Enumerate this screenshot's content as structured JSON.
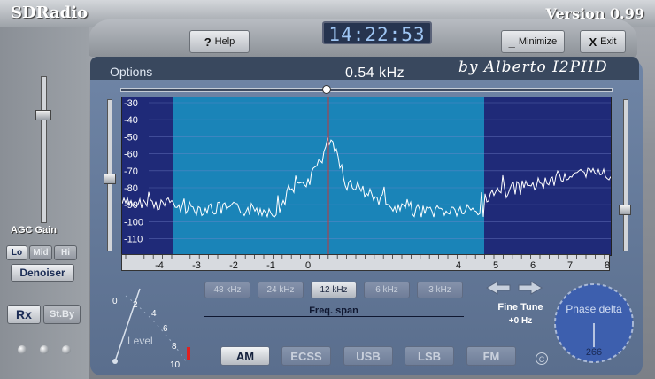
{
  "window": {
    "app_title": "SDRadio",
    "version": "Version 0.99"
  },
  "toolbar": {
    "help_label": "Help",
    "help_icon": "?",
    "minimize_label": "Minimize",
    "minimize_icon": "_",
    "exit_label": "Exit",
    "exit_icon": "X"
  },
  "clock": "14:22:53",
  "header": {
    "options_label": "Options",
    "center_freq": "0.54 kHz",
    "author": "by Alberto I2PHD"
  },
  "agc": {
    "label": "AGC Gain",
    "buttons": [
      {
        "label": "Lo",
        "active": true
      },
      {
        "label": "Mid",
        "active": false
      },
      {
        "label": "Hi",
        "active": false
      }
    ],
    "denoiser_label": "Denoiser"
  },
  "rx": {
    "rx_label": "Rx",
    "standby_label": "St.By"
  },
  "spectrum": {
    "db_labels": [
      "-30",
      "-40",
      "-50",
      "-60",
      "-70",
      "-80",
      "-90",
      "-100",
      "-110"
    ],
    "freq_labels": [
      "-4",
      "-3",
      "-2",
      "-1",
      "0",
      "4",
      "5",
      "6",
      "7",
      "8"
    ],
    "colors": {
      "background": "#1f2a78",
      "passband": "#1a84b8",
      "trace": "#ffffff",
      "marker": "#c0393b",
      "grid": "#7a87cc"
    }
  },
  "span": {
    "buttons": [
      {
        "label": "48 kHz",
        "selected": false
      },
      {
        "label": "24 kHz",
        "selected": false
      },
      {
        "label": "12 kHz",
        "selected": true
      },
      {
        "label": "6 kHz",
        "selected": false
      },
      {
        "label": "3 kHz",
        "selected": false
      }
    ],
    "label": "Freq. span"
  },
  "fine_tune": {
    "label": "Fine Tune",
    "value": "+0 Hz"
  },
  "modes": [
    {
      "label": "AM",
      "selected": true
    },
    {
      "label": "ECSS",
      "selected": false
    },
    {
      "label": "USB",
      "selected": false
    },
    {
      "label": "LSB",
      "selected": false
    },
    {
      "label": "FM",
      "selected": false
    }
  ],
  "level": {
    "label": "Level",
    "ticks": [
      "0",
      "2",
      "4",
      "6",
      "8",
      "10"
    ]
  },
  "phase": {
    "label": "Phase delta",
    "value": "266"
  }
}
